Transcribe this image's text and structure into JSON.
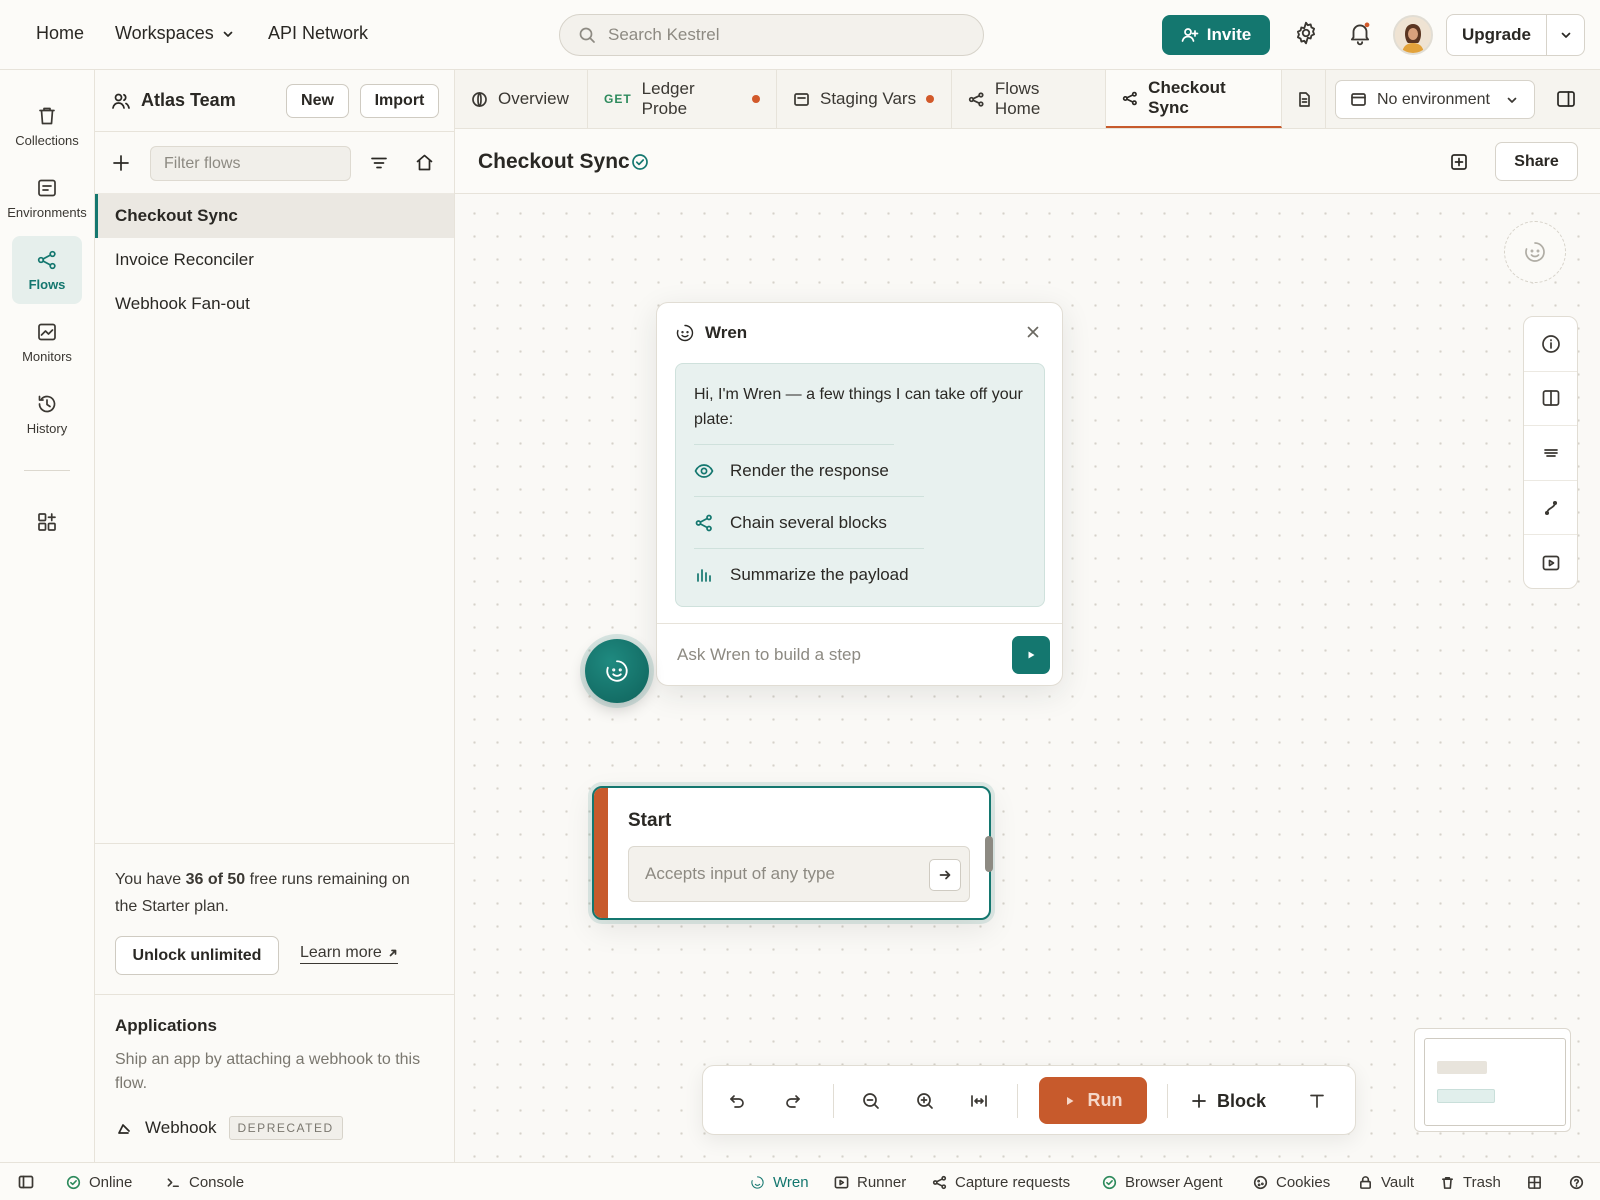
{
  "topnav": {
    "home": "Home",
    "workspaces": "Workspaces",
    "api_network": "API Network",
    "search_placeholder": "Search Kestrel",
    "invite": "Invite",
    "upgrade": "Upgrade"
  },
  "rail": {
    "items": [
      {
        "label": "Collections",
        "icon": "trash-icon"
      },
      {
        "label": "Environments",
        "icon": "environment-icon"
      },
      {
        "label": "Flows",
        "icon": "flows-icon",
        "active": true
      },
      {
        "label": "Monitors",
        "icon": "monitor-icon"
      },
      {
        "label": "History",
        "icon": "history-icon"
      }
    ]
  },
  "sidebar": {
    "team": "Atlas Team",
    "new_label": "New",
    "import_label": "Import",
    "filter_placeholder": "Filter flows",
    "flows": [
      "Checkout Sync",
      "Invoice Reconciler",
      "Webhook Fan-out"
    ],
    "active_flow": "Checkout Sync",
    "quota": {
      "prefix": "You have",
      "used": "36 of 50",
      "suffix": "free runs remaining on the Starter plan.",
      "unlock": "Unlock unlimited",
      "learn_more": "Learn more"
    },
    "apps": {
      "title": "Applications",
      "description": "Ship an app by attaching a webhook to this flow.",
      "webhook": "Webhook",
      "badge": "DEPRECATED"
    }
  },
  "tabs": [
    {
      "label": "Overview",
      "icon": "globe-icon"
    },
    {
      "method": "GET",
      "label": "Ledger Probe",
      "unsaved": true
    },
    {
      "label": "Staging Vars",
      "icon": "environment-icon",
      "unsaved": true
    },
    {
      "label": "Flows Home",
      "icon": "flows-icon"
    },
    {
      "label": "Checkout Sync",
      "icon": "flows-icon",
      "active": true
    }
  ],
  "environment": "No environment",
  "flow": {
    "title": "Checkout Sync",
    "share": "Share"
  },
  "wren": {
    "title": "Wren",
    "greeting": "Hi, I'm Wren — a few things I can take off your plate:",
    "suggestions": [
      {
        "label": "Render the response",
        "icon": "eye-icon"
      },
      {
        "label": "Chain several blocks",
        "icon": "share-nodes-icon"
      },
      {
        "label": "Summarize the payload",
        "icon": "bar-chart-icon"
      }
    ],
    "input_placeholder": "Ask Wren to build a step"
  },
  "start_node": {
    "title": "Start",
    "placeholder": "Accepts input of any type"
  },
  "toolbar": {
    "run": "Run",
    "block": "Block"
  },
  "statusbar": {
    "online": "Online",
    "console": "Console",
    "wren": "Wren",
    "runner": "Runner",
    "capture": "Capture requests",
    "browser_agent": "Browser Agent",
    "cookies": "Cookies",
    "vault": "Vault",
    "trash": "Trash"
  },
  "colors": {
    "accent": "#14776f",
    "run": "#c75a2c",
    "unsaved_dot": "#d2592a"
  }
}
